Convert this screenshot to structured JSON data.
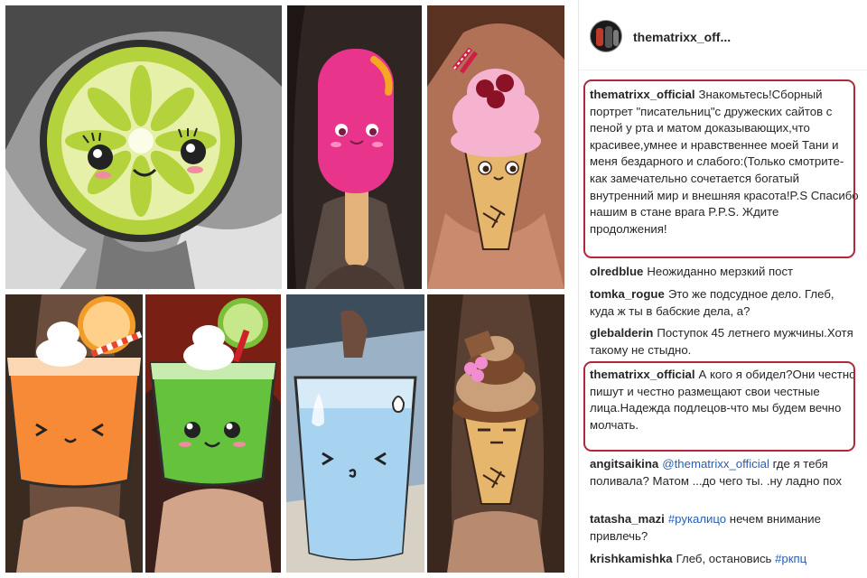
{
  "post": {
    "username": "thematrixx_off..."
  },
  "comments": [
    {
      "user": "thematrixx_official",
      "text": "Знакомьтесь!Сборный портрет \"писательниц\"с дружеских сайтов с пеной у рта и матом доказывающих,что красивее,умнее и нравственнее моей Тани и меня бездарного и слабого:(Только смотрите-как замечательно сочетается богатый внутренний мир и внешняя красота!P.S Спасибо нашим в стане врага P.P.S. Ждите продолжения!"
    },
    {
      "user": "olredblue",
      "text": "Неожиданно мерзкий пост"
    },
    {
      "user": "tomka_rogue",
      "text": "Это же подсудное дело. Глеб, куда ж ты в бабские дела, а?"
    },
    {
      "user": "glebalderin",
      "text": "Поступок 45 летнего мужчины.Хотя такому не стыдно."
    },
    {
      "user": "thematrixx_official",
      "text": "А кого я обидел?Они честно пишут и честно размещают свои честные лица.Надежда подлецов-что мы будем вечно молчать."
    },
    {
      "user": "angitsaikina",
      "mention": "@thematrixx_official",
      "text": " где я тебя поливала? Матом ...до чего ты. .ну ладно пох"
    },
    {
      "user": "tatasha_mazi",
      "hashtag": "#рукалицо",
      "text": " нечем внимание привлечь?"
    },
    {
      "user": "krishkamishka",
      "text": "Глеб, остановись ",
      "hashtag": "#ркпц"
    }
  ],
  "colors": {
    "highlight_border": "#b0283a",
    "link": "#2a5db0"
  },
  "icons": {
    "tile1": "lime-face-sticker",
    "tile2": "popsicle-sticker",
    "tile3": "ice-cream-cone-sticker",
    "tile4": "orange-juice-glass-sticker",
    "tile5": "green-juice-glass-sticker",
    "tile6": "water-glass-sticker",
    "tile7": "chocolate-ice-cream-sticker"
  }
}
